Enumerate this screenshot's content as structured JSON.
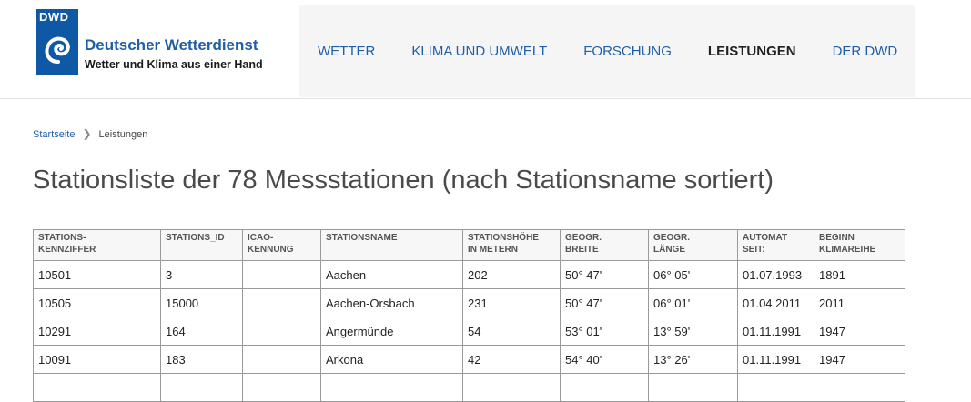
{
  "logo": {
    "abbr": "DWD",
    "name": "Deutscher Wetterdienst",
    "tagline": "Wetter und Klima aus einer Hand"
  },
  "nav": [
    "WETTER",
    "KLIMA UND UMWELT",
    "FORSCHUNG",
    "LEISTUNGEN",
    "DER DWD"
  ],
  "nav_active": "LEISTUNGEN",
  "breadcrumb": {
    "home": "Startseite",
    "current": "Leistungen"
  },
  "page_title": "Stationsliste der 78 Messstationen (nach Stationsname sortiert)",
  "table": {
    "headers": [
      "STATIONS-\nKENNZIFFER",
      "STATIONS_ID",
      "ICAO-\nKENNUNG",
      "STATIONSNAME",
      "STATIONSHÖHE\nIN METERN",
      "GEOGR.\nBREITE",
      "GEOGR.\nLÄNGE",
      "AUTOMAT\nSEIT:",
      "BEGINN\nKLIMAREIHE"
    ],
    "rows": [
      [
        "10501",
        "3",
        "",
        "Aachen",
        "202",
        "50° 47'",
        "06° 05'",
        "01.07.1993",
        "1891"
      ],
      [
        "10505",
        "15000",
        "",
        "Aachen-Orsbach",
        "231",
        "50° 47'",
        "06° 01'",
        "01.04.2011",
        "2011"
      ],
      [
        "10291",
        "164",
        "",
        "Angermünde",
        "54",
        "53° 01'",
        "13° 59'",
        "01.11.1991",
        "1947"
      ],
      [
        "10091",
        "183",
        "",
        "Arkona",
        "42",
        "54° 40'",
        "13° 26'",
        "01.11.1991",
        "1947"
      ],
      [
        "",
        "",
        "",
        "",
        "",
        "",
        "",
        "",
        ""
      ]
    ]
  },
  "colors": {
    "brand_blue": "#0f58a6",
    "link_blue": "#1f5ea8",
    "nav_bg": "#f5f5f5"
  }
}
